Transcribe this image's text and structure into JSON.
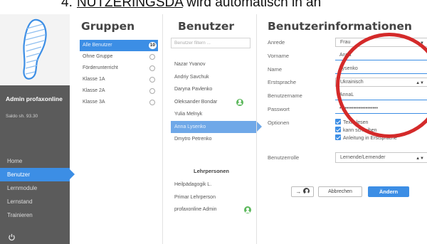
{
  "caption": {
    "number": "4.",
    "link_text": "NUTZERINGSDA",
    "text": "wird automatisch in an"
  },
  "sidebar": {
    "admin_title": "Admin profaxonline",
    "saldo": "Saldo sh. 93.30",
    "nav": [
      "Home",
      "Benutzer",
      "Lernmodule",
      "Lernstand",
      "Trainieren"
    ]
  },
  "gruppen": {
    "title": "Gruppen",
    "items": [
      {
        "label": "Alle Benutzer",
        "badge": "10"
      },
      {
        "label": "Ohne Gruppe"
      },
      {
        "label": "Förderunterricht"
      },
      {
        "label": "Klasse 1A"
      },
      {
        "label": "Klasse 2A"
      },
      {
        "label": "Klasse 3A"
      }
    ]
  },
  "benutzer": {
    "title": "Benutzer",
    "filter_placeholder": "Benutzer filtern ...",
    "users": [
      "Nazar Yvanov",
      "Andriy Savchuk",
      "Daryna Pavlenko",
      "Oleksander Bondar",
      "Yulia Melnyk",
      "Anna Lysenko",
      "Dmytro Petrenko"
    ],
    "staff_title": "Lehrpersonen",
    "staff": [
      "Heilpädagogik L.",
      "Primar Lehrperson",
      "profaxonline Admin"
    ]
  },
  "info": {
    "title": "Benutzerinformationen",
    "labels": {
      "anrede": "Anrede",
      "vorname": "Vorname",
      "name": "Name",
      "erstsprache": "Erstsprache",
      "benutzername": "Benutzername",
      "passwort": "Passwort",
      "optionen": "Optionen",
      "benutzerrolle": "Benutzerrolle"
    },
    "values": {
      "anrede": "Frau",
      "vorname": "Anna",
      "name": "Lysenko",
      "erstsprache": "Ukrainisch",
      "benutzername": "AnnaL",
      "passwort": "••••••••••••••••••••••",
      "benutzerrolle": "Lernende/Lernender"
    },
    "options": [
      "Texte lesen",
      "kann schreiben",
      "Anleitung in Erstsprache"
    ],
    "arrow_button": "→",
    "cancel": "Abbrechen",
    "save": "Ändern"
  },
  "colors": {
    "accent": "#3c8ee5",
    "sidebar_dark": "#5b5b5b",
    "annotation_red": "#d42a2a",
    "user_badge_green": "#5cb85c"
  }
}
